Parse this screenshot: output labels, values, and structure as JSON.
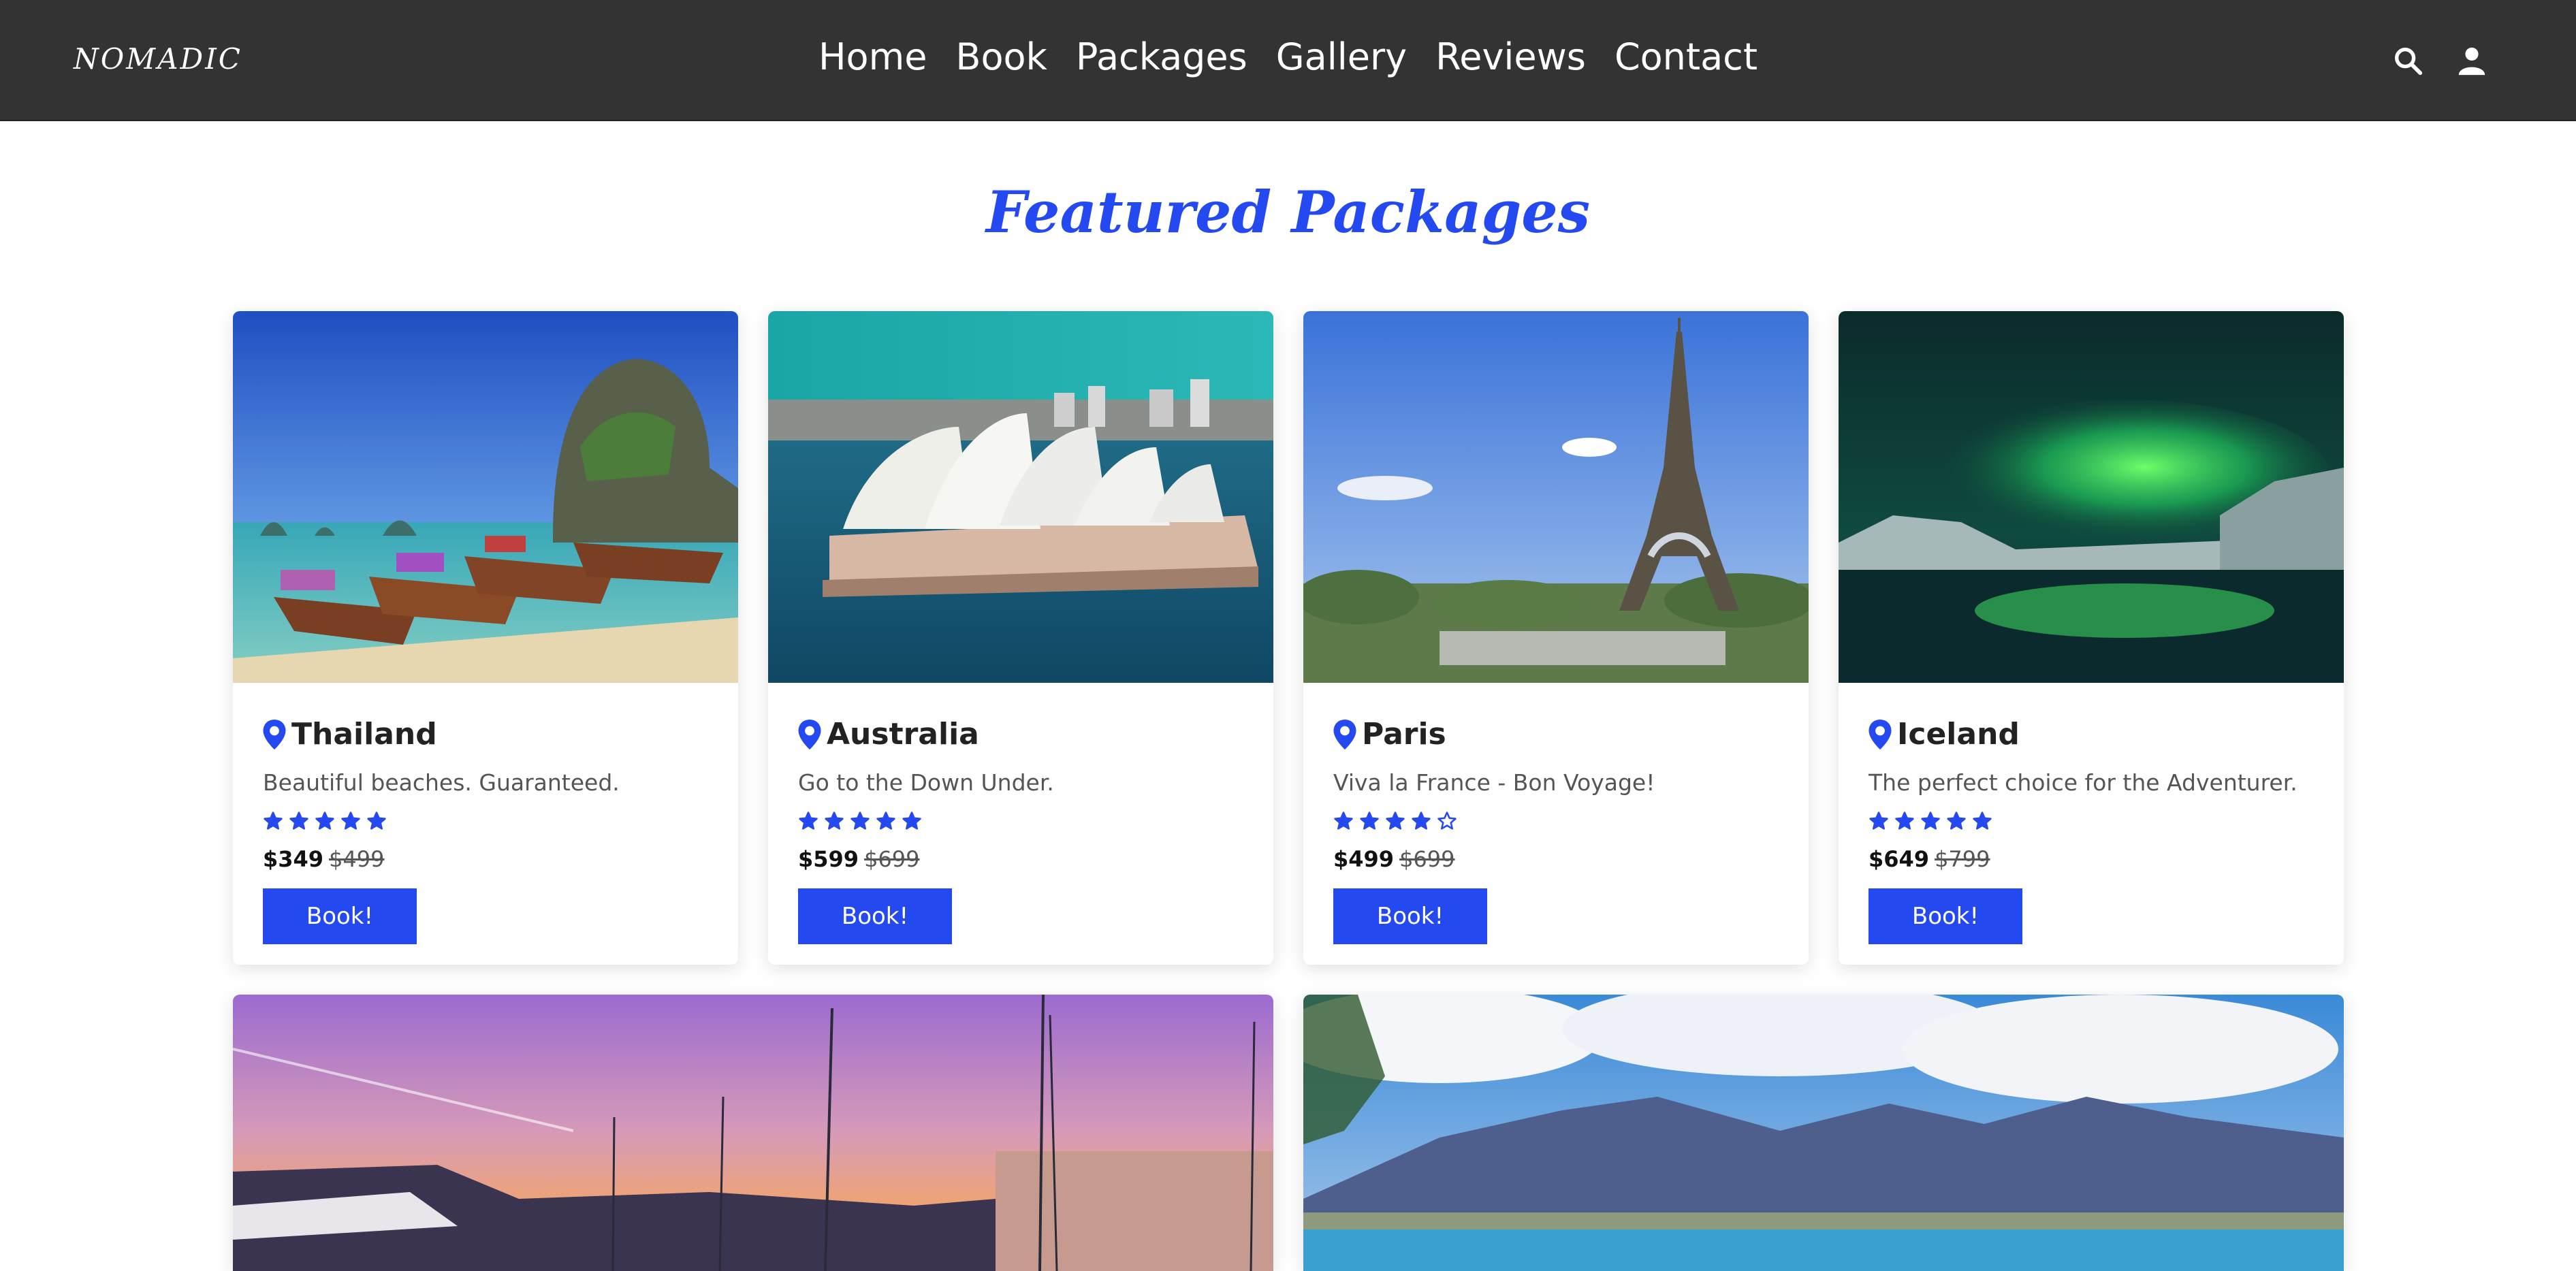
{
  "nav": {
    "logo": "NOMADIC",
    "links": [
      "Home",
      "Book",
      "Packages",
      "Gallery",
      "Reviews",
      "Contact"
    ],
    "icons": [
      "search-icon",
      "user-icon"
    ]
  },
  "featured": {
    "title": "Featured Packages",
    "packages": [
      {
        "place": "Thailand",
        "desc": "Beautiful beaches. Guaranteed.",
        "rating": 5,
        "price": "$349",
        "old_price": "$499",
        "button": "Book!"
      },
      {
        "place": "Australia",
        "desc": "Go to the Down Under.",
        "rating": 5,
        "price": "$599",
        "old_price": "$699",
        "button": "Book!"
      },
      {
        "place": "Paris",
        "desc": "Viva la France - Bon Voyage!",
        "rating": 4,
        "price": "$499",
        "old_price": "$699",
        "button": "Book!"
      },
      {
        "place": "Iceland",
        "desc": "The perfect choice for the Adventurer.",
        "rating": 5,
        "price": "$649",
        "old_price": "$799",
        "button": "Book!"
      }
    ]
  },
  "colors": {
    "accent": "#2549f0",
    "navbar": "#333333"
  }
}
